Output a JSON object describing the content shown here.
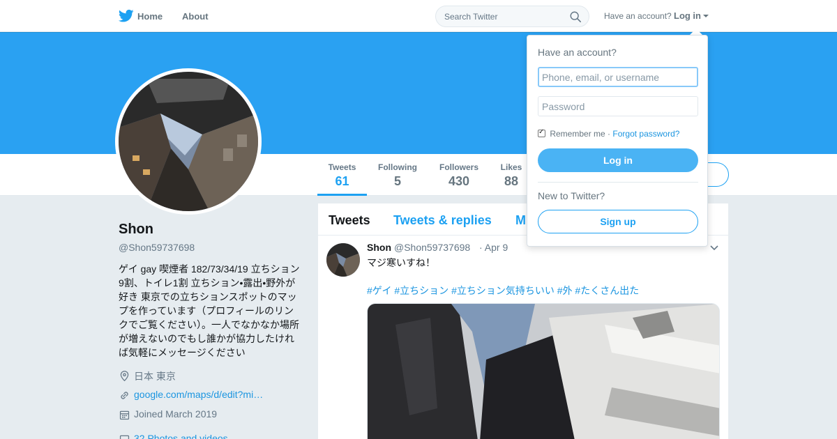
{
  "nav": {
    "home": "Home",
    "about": "About",
    "search_placeholder": "Search Twitter",
    "have_account": "Have an account?",
    "login": "Log in"
  },
  "profile": {
    "name": "Shon",
    "handle": "@Shon59737698",
    "bio": "ゲイ gay 喫煙者 182/73/34/19 立ちション9割、トイレ1割 立ちション•露出•野外が好き 東京での立ちションスポットのマップを作っています（プロフィールのリンクでご覧ください）。一人でなかなか場所が増えないのでもし誰かが協力したければ気軽にメッセージください",
    "location": "日本 東京",
    "url": "google.com/maps/d/edit?mi…",
    "joined": "Joined March 2019",
    "photos": "32 Photos and videos"
  },
  "stats": [
    {
      "label": "Tweets",
      "value": "61"
    },
    {
      "label": "Following",
      "value": "5"
    },
    {
      "label": "Followers",
      "value": "430"
    },
    {
      "label": "Likes",
      "value": "88"
    }
  ],
  "timeline": {
    "tabs": [
      "Tweets",
      "Tweets & replies",
      "M"
    ],
    "tweet": {
      "name": "Shon",
      "handle": "@Shon59737698",
      "date": "· Apr 9",
      "text": "マジ寒いすね！",
      "tags": "#ゲイ #立ちション #立ちション気持ちいい #外 #たくさん出た"
    }
  },
  "login_dropdown": {
    "title": "Have an account?",
    "username_placeholder": "Phone, email, or username",
    "password_placeholder": "Password",
    "remember": "Remember me",
    "separator": "·",
    "forgot": "Forgot password?",
    "login_button": "Log in",
    "new_to": "New to Twitter?",
    "signup_button": "Sign up"
  },
  "colors": {
    "brand": "#1da1f2",
    "banner": "#2aa1f2",
    "login_button": "#4ab3f4"
  }
}
